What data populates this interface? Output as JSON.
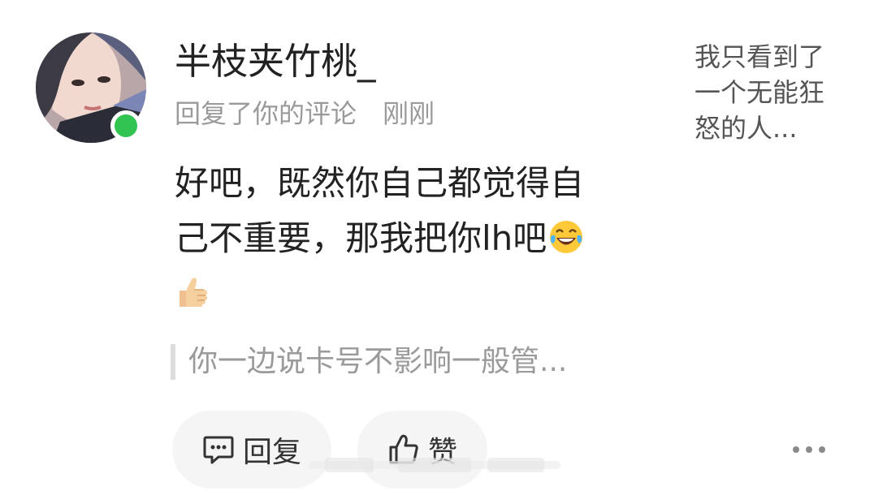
{
  "user": {
    "name": "半枝夹竹桃_",
    "online": true
  },
  "meta": {
    "action": "回复了你的评论",
    "time": "刚刚"
  },
  "comment": {
    "line1": "好吧，既然你自己都觉得自",
    "line2": "己不重要，那我把你lh吧",
    "emojis": [
      "laugh-cry-emoji",
      "thumbs-up-emoji"
    ]
  },
  "quote": {
    "text": "你一边说卡号不影响一般管..."
  },
  "actions": {
    "reply_label": "回复",
    "like_label": "赞"
  },
  "preview": {
    "lines": [
      "我只看到了",
      "一个无能狂",
      "怒的人..."
    ]
  },
  "colors": {
    "online": "#31c451",
    "muted_text": "#9a9a9a",
    "pill_bg": "#f5f5f5"
  }
}
